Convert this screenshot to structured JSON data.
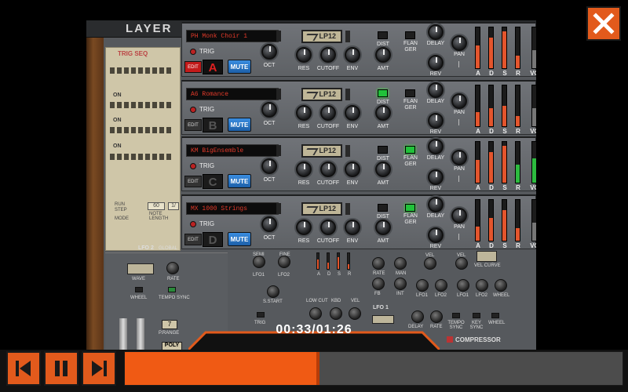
{
  "player": {
    "current_time": "00:33/01:26",
    "progress_fraction": 0.391,
    "accent_color": "#e25a1c"
  },
  "controls": {
    "skip_back_icon": "skip-back-icon",
    "pause_icon": "pause-icon",
    "skip_forward_icon": "skip-forward-icon",
    "close_icon": "close-icon"
  },
  "device": {
    "title": "LAYER",
    "trig_seq_label": "TRIG SEQ",
    "seq_on_labels": [
      "ON",
      "ON",
      "ON"
    ],
    "mode_labels": {
      "run": "RUN",
      "step": "STEP",
      "mode": "MODE",
      "note": "NOTE",
      "length": "LENGTH",
      "note_value": "60",
      "length_value": "1/"
    },
    "lfo2_label": "LFO 2",
    "lfo2_global": "GLOBAL",
    "lfo2_controls": {
      "wave": "WAVE",
      "rate": "RATE",
      "wheel": "WHEEL",
      "tempo_sync": "TEMPO SYNC"
    },
    "prange_label": "P.RANGE",
    "prange_value": "7",
    "poly_label": "POLY",
    "mid_labels": {
      "semi": "SEMI",
      "fine": "FINE",
      "lfo1": "LFO1",
      "lfo2": "LFO2",
      "s_start": "S.START",
      "trig": "TRIG",
      "low_cut": "LOW CUT",
      "kbd": "KBD",
      "vel": "VEL",
      "adsr": [
        "A",
        "D",
        "S",
        "R"
      ],
      "rate": "RATE",
      "man": "MAN",
      "fb": "FB",
      "int": "INT",
      "vel_curve": "VEL CURVE",
      "wheel": "WHEEL",
      "lfo1_title": "LFO 1",
      "delay": "DELAY",
      "tempo_sync": "TEMPO SYNC",
      "key_sync": "KEY SYNC",
      "compressor": "COMPRESSOR"
    }
  },
  "layers": [
    {
      "letter": "A",
      "patch": "PH Monk Choir 1",
      "active": true,
      "dist_on": false,
      "flanger_on": false,
      "sliders": [
        0.55,
        0.75,
        0.9,
        0.3
      ]
    },
    {
      "letter": "B",
      "patch": "A6 Romance",
      "active": false,
      "dist_on": true,
      "flanger_on": false,
      "sliders": [
        0.35,
        0.45,
        0.5,
        0.25
      ]
    },
    {
      "letter": "C",
      "patch": "KM BigEnsemble",
      "active": false,
      "dist_on": false,
      "flanger_on": true,
      "sliders": [
        0.55,
        0.75,
        0.9,
        0.45
      ]
    },
    {
      "letter": "D",
      "patch": "MX 1000 Strings",
      "active": false,
      "dist_on": false,
      "flanger_on": true,
      "sliders": [
        0.35,
        0.55,
        0.75,
        0.3
      ]
    }
  ],
  "layer_labels": {
    "trig": "TRIG",
    "edit": "EDIT",
    "mute": "MUTE",
    "oct": "OCT",
    "filter_mode": "LP12",
    "res": "RES",
    "cutoff": "CUTOFF",
    "env": "ENV",
    "dist": "DIST",
    "flanger": "FLAN GER",
    "amt": "AMT",
    "delay": "DELAY",
    "rev": "REV",
    "pan": "PAN",
    "adsr": [
      "A",
      "D",
      "S",
      "R"
    ],
    "vol": "VO"
  },
  "colors": {
    "slider_orange": "#e4552d",
    "slider_green": "#2dbb3f",
    "mute_blue": "#2a75c8",
    "led_red": "#c31a1a",
    "lcd_text_red": "#e23a2a"
  }
}
